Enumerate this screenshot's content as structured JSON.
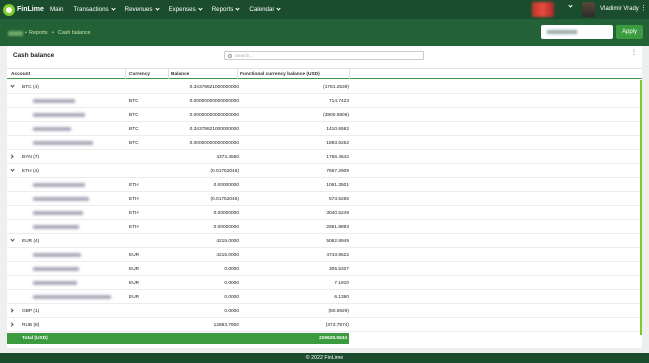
{
  "brand": {
    "name": "FinLime"
  },
  "nav": [
    {
      "label": "Main",
      "dropdown": false
    },
    {
      "label": "Transactions",
      "dropdown": true
    },
    {
      "label": "Revenues",
      "dropdown": true
    },
    {
      "label": "Expenses",
      "dropdown": true
    },
    {
      "label": "Reports",
      "dropdown": true
    },
    {
      "label": "Calendar",
      "dropdown": true
    }
  ],
  "user": {
    "name": "Vladimir Vrady"
  },
  "breadcrumb": {
    "reports": "Reports",
    "separator": "•",
    "current": "Cash balance"
  },
  "toolbar": {
    "apply_label": "Apply"
  },
  "card": {
    "title": "Cash balance",
    "search_placeholder": "Search..."
  },
  "table": {
    "headers": {
      "account": "Account",
      "currency": "Currency",
      "balance": "Balance",
      "functional": "Functional currency balance (USD)"
    },
    "rows": [
      {
        "type": "group",
        "expanded": true,
        "account": "BTC (4)",
        "currency": "",
        "balance": "0.34379821000000000",
        "functional": "(1781.2539)"
      },
      {
        "type": "child",
        "currency": "BTC",
        "balance": "0.00000000000000000",
        "functional": "714.7423"
      },
      {
        "type": "child",
        "currency": "BTC",
        "balance": "0.00000000000000000",
        "functional": "(3800.5806)"
      },
      {
        "type": "child",
        "currency": "BTC",
        "balance": "0.34379821000000000",
        "functional": "1410.6582"
      },
      {
        "type": "child",
        "currency": "BTC",
        "balance": "0.00000000000000000",
        "functional": "1893.6262"
      },
      {
        "type": "group",
        "expanded": false,
        "account": "BYN (7)",
        "currency": "",
        "balance": "4373.4550",
        "functional": "1766.4542"
      },
      {
        "type": "group",
        "expanded": true,
        "account": "ETH (4)",
        "currency": "",
        "balance": "(0.01752046)",
        "functional": "7657.2909"
      },
      {
        "type": "child",
        "currency": "ETH",
        "balance": "0.00000000",
        "functional": "1091.3501"
      },
      {
        "type": "child",
        "currency": "ETH",
        "balance": "(0.01752046)",
        "functional": "573.5265"
      },
      {
        "type": "child",
        "currency": "ETH",
        "balance": "0.00000000",
        "functional": "3040.5249"
      },
      {
        "type": "child",
        "currency": "ETH",
        "balance": "0.00000000",
        "functional": "2951.8893"
      },
      {
        "type": "group",
        "expanded": true,
        "account": "EUR (4)",
        "currency": "",
        "balance": "4215.0000",
        "functional": "5062.8949"
      },
      {
        "type": "child",
        "currency": "EUR",
        "balance": "4215.0000",
        "functional": "4743.8522"
      },
      {
        "type": "child",
        "currency": "EUR",
        "balance": "0.0000",
        "functional": "305.5327"
      },
      {
        "type": "child",
        "currency": "EUR",
        "balance": "0.0000",
        "functional": "7.1910"
      },
      {
        "type": "child",
        "currency": "EUR",
        "balance": "0.0000",
        "functional": "6.1390"
      },
      {
        "type": "group",
        "expanded": false,
        "account": "GBP (1)",
        "currency": "",
        "balance": "0.0000",
        "functional": "(60.6929)"
      },
      {
        "type": "group",
        "expanded": false,
        "account": "RUB (8)",
        "currency": "",
        "balance": "12883.7800",
        "functional": "(373.7974)"
      }
    ],
    "total": {
      "label": "Total (USD)",
      "value": "226628.5534"
    }
  },
  "footer": {
    "text": "© 2022 FinLime"
  },
  "colors": {
    "header_bg": "#1a4c2d",
    "subbar_bg": "#236136",
    "accent": "#3a9b3f",
    "lime": "#7ecb2c"
  }
}
